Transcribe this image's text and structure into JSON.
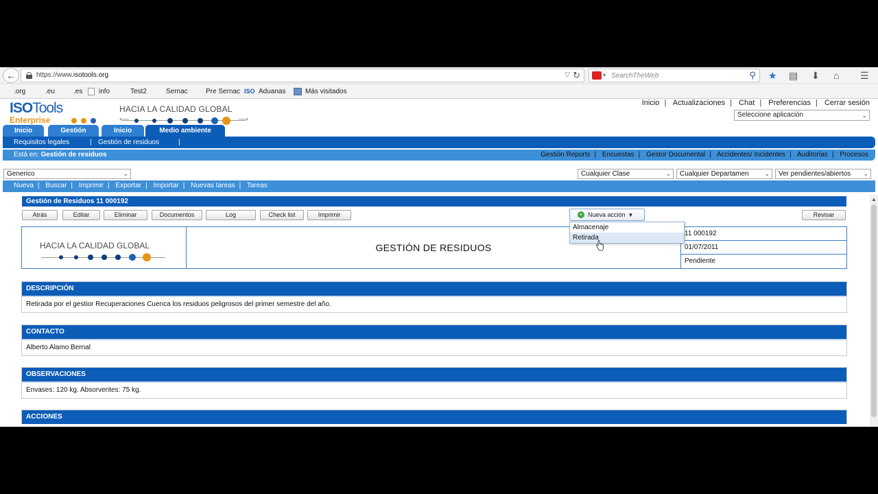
{
  "browser": {
    "url_prefix": "https://www.",
    "url_domain": "isotools.org",
    "search_placeholder": "SearchTheWeb",
    "bookmarks": [
      ".org",
      ".eu",
      ".es",
      "info",
      "Test2",
      "Sernac",
      "Pre Sernac",
      "ISO",
      "Aduanas",
      "Más visitados"
    ]
  },
  "header": {
    "logo_iso": "ISO",
    "logo_tools": "Tools",
    "logo_enterprise": "Enterprise",
    "brand_title": "HACIA LA CALIDAD GLOBAL",
    "top_links": [
      "Inicio",
      "Actualizaciones",
      "Chat",
      "Preferencias",
      "Cerrar sesión"
    ],
    "app_select": "Seleccione aplicación",
    "colors": {
      "primary": "#0c5db8",
      "accent": "#e69518",
      "light": "#3d8fd8"
    }
  },
  "tabs": [
    "Inicio",
    "Gestión",
    "Inicio",
    "Medio ambiente"
  ],
  "subnav": [
    "Requisitos legales",
    "Gestión de residuos"
  ],
  "breadcrumb": {
    "label": "Está en:",
    "current": "Gestión de residuos"
  },
  "module_nav": [
    "Gestión Reports",
    "Encuestas",
    "Gestor Documental",
    "Accidentes/ Incidentes",
    "Auditorías",
    "Procesos"
  ],
  "filters": {
    "generic": "Generico",
    "clase": "Cualquier Clase",
    "departamento": "Cualquier Departamen",
    "estado": "Ver pendientes/abiertos"
  },
  "action_bar": [
    "Nueva",
    "Buscar",
    "Imprimir",
    "Exportar",
    "Importar",
    "Nuevas tareas",
    "Tareas"
  ],
  "record": {
    "panel_title": "Gestión de Residuos 11 000192",
    "buttons": [
      "Atrás",
      "Editar",
      "Eliminar",
      "Documentos",
      "Log",
      "Check list",
      "Imprimir"
    ],
    "nueva_accion": "Nueva acción",
    "revisar": "Revisar",
    "doc_title": "GESTIÓN DE RESIDUOS",
    "code": "11 000192",
    "date": "01/07/2011",
    "status": "Pendiente",
    "dropdown_options": [
      "Almacenaje",
      "Retirada"
    ]
  },
  "sections": [
    {
      "title": "DESCRIPCIÓN",
      "body": "Retirada por el gestior Recuperaciones Cuenca los residuos peligrosos del primer semestre del año."
    },
    {
      "title": "CONTACTO",
      "body": "Alberto Alamo Bernal"
    },
    {
      "title": "OBSERVACIONES",
      "body": "Envases: 120 kg. Absorventes: 75 kg."
    },
    {
      "title": "ACCIONES",
      "body": ""
    }
  ]
}
